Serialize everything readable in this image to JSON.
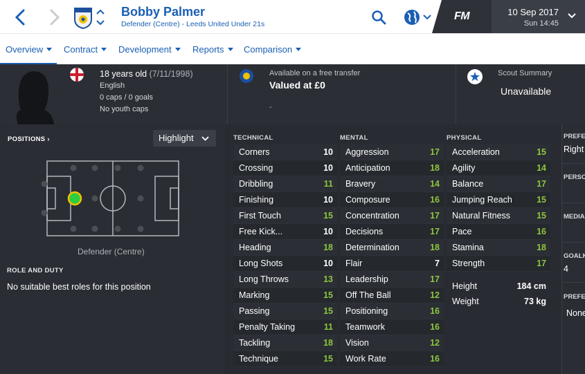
{
  "player": {
    "name": "Bobby Palmer",
    "subtitle": "Defender (Centre) - Leeds United Under 21s"
  },
  "header": {
    "logo_text": "FM",
    "date": "10 Sep 2017",
    "day_time": "Sun 14:45"
  },
  "tabs": [
    {
      "label": "Overview"
    },
    {
      "label": "Contract"
    },
    {
      "label": "Development"
    },
    {
      "label": "Reports"
    },
    {
      "label": "Comparison"
    }
  ],
  "info": {
    "age": "18 years old",
    "dob": "(7/11/1998)",
    "nationality": "English",
    "caps": "0 caps / 0 goals",
    "youth_caps": "No youth caps",
    "transfer_status": "Available on a free transfer",
    "value": "Valued at £0",
    "value_note": "-",
    "scout_title": "Scout Summary",
    "scout_value": "Unavailable"
  },
  "positions": {
    "title": "POSITIONS",
    "highlight_label": "Highlight",
    "position_label": "Defender (Centre)",
    "role_title": "ROLE AND DUTY",
    "role_text": "No suitable best roles for this position"
  },
  "attributes": {
    "technical": {
      "title": "TECHNICAL",
      "rows": [
        {
          "name": "Corners",
          "value": "10"
        },
        {
          "name": "Crossing",
          "value": "10"
        },
        {
          "name": "Dribbling",
          "value": "11"
        },
        {
          "name": "Finishing",
          "value": "10"
        },
        {
          "name": "First Touch",
          "value": "15"
        },
        {
          "name": "Free Kick...",
          "value": "10"
        },
        {
          "name": "Heading",
          "value": "18"
        },
        {
          "name": "Long Shots",
          "value": "10"
        },
        {
          "name": "Long Throws",
          "value": "13"
        },
        {
          "name": "Marking",
          "value": "15"
        },
        {
          "name": "Passing",
          "value": "15"
        },
        {
          "name": "Penalty Taking",
          "value": "11"
        },
        {
          "name": "Tackling",
          "value": "18"
        },
        {
          "name": "Technique",
          "value": "15"
        }
      ]
    },
    "mental": {
      "title": "MENTAL",
      "rows": [
        {
          "name": "Aggression",
          "value": "17"
        },
        {
          "name": "Anticipation",
          "value": "18"
        },
        {
          "name": "Bravery",
          "value": "14"
        },
        {
          "name": "Composure",
          "value": "16"
        },
        {
          "name": "Concentration",
          "value": "17"
        },
        {
          "name": "Decisions",
          "value": "17"
        },
        {
          "name": "Determination",
          "value": "18"
        },
        {
          "name": "Flair",
          "value": "7"
        },
        {
          "name": "Leadership",
          "value": "17"
        },
        {
          "name": "Off The Ball",
          "value": "12"
        },
        {
          "name": "Positioning",
          "value": "16"
        },
        {
          "name": "Teamwork",
          "value": "16"
        },
        {
          "name": "Vision",
          "value": "12"
        },
        {
          "name": "Work Rate",
          "value": "16"
        }
      ]
    },
    "physical": {
      "title": "PHYSICAL",
      "rows": [
        {
          "name": "Acceleration",
          "value": "15"
        },
        {
          "name": "Agility",
          "value": "14"
        },
        {
          "name": "Balance",
          "value": "17"
        },
        {
          "name": "Jumping Reach",
          "value": "15"
        },
        {
          "name": "Natural Fitness",
          "value": "15"
        },
        {
          "name": "Pace",
          "value": "16"
        },
        {
          "name": "Stamina",
          "value": "18"
        },
        {
          "name": "Strength",
          "value": "17"
        }
      ],
      "height_label": "Height",
      "height_value": "184 cm",
      "weight_label": "Weight",
      "weight_value": "73 kg"
    }
  },
  "right_panel": {
    "pref_foot_title": "PREFE",
    "pref_foot_value": "Right",
    "personality_title": "PERSO",
    "media_title": "MEDIA",
    "goals_title": "GOALK",
    "goals_value": "4",
    "pref2_title": "PREFE",
    "pref2_value": "None"
  },
  "colors": {
    "accent": "#1a5fb4",
    "value_green": "#8dc63f",
    "position_dot": "#2ecc40",
    "panel_bg": "#2a2d33"
  }
}
